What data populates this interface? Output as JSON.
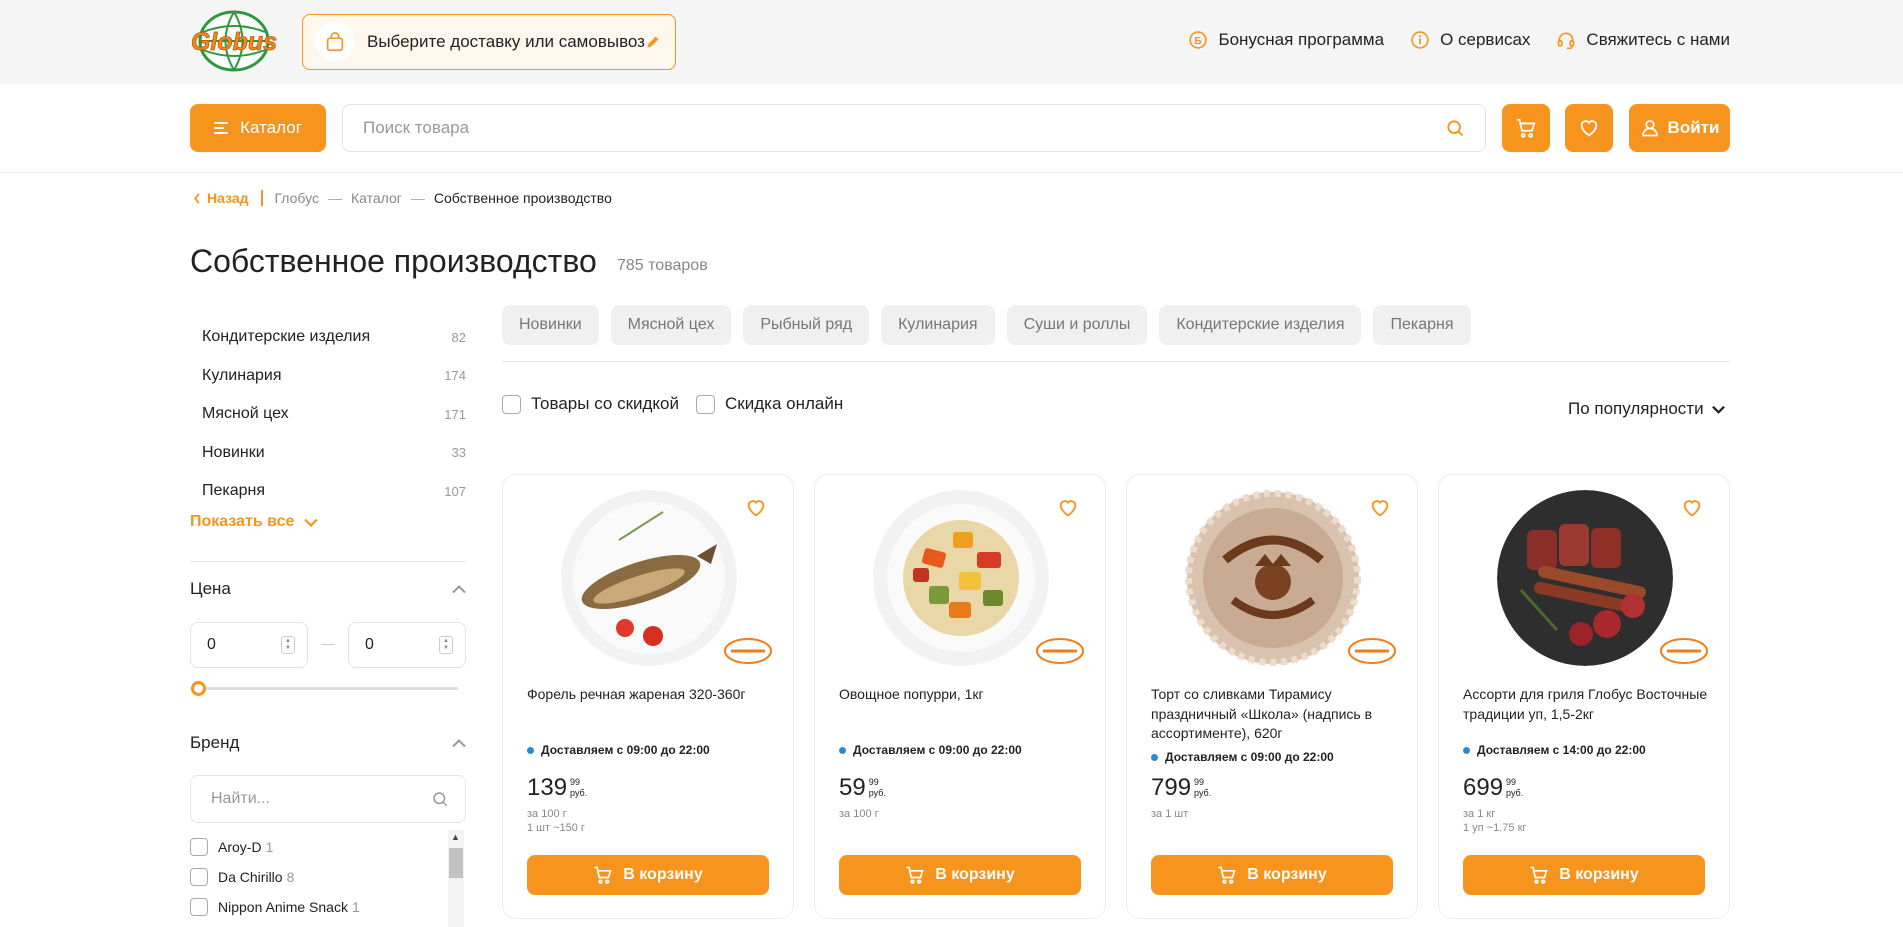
{
  "header": {
    "logo_text": "Globus",
    "delivery_label": "Выберите доставку или самовывоз",
    "links": [
      {
        "label": "Бонусная программа",
        "icon": "bonus-coin-icon"
      },
      {
        "label": "О сервисах",
        "icon": "info-icon"
      },
      {
        "label": "Свяжитесь с нами",
        "icon": "headset-icon"
      }
    ]
  },
  "toolbar": {
    "catalog_label": "Каталог",
    "search_placeholder": "Поиск товара",
    "login_label": "Войти"
  },
  "breadcrumb": {
    "back_label": "Назад",
    "items": [
      "Глобус",
      "Каталог",
      "Собственное производство"
    ]
  },
  "page": {
    "title": "Собственное производство",
    "count": "785 товаров"
  },
  "sidebar": {
    "categories": [
      {
        "name": "Кондитерские изделия",
        "count": "82"
      },
      {
        "name": "Кулинария",
        "count": "174"
      },
      {
        "name": "Мясной цех",
        "count": "171"
      },
      {
        "name": "Новинки",
        "count": "33"
      },
      {
        "name": "Пекарня",
        "count": "107"
      }
    ],
    "show_all_label": "Показать все",
    "price": {
      "title": "Цена",
      "min": "0",
      "max": "0"
    },
    "brand": {
      "title": "Бренд",
      "search_placeholder": "Найти...",
      "items": [
        {
          "name": "Aroy-D",
          "count": "1"
        },
        {
          "name": "Da Chirillo",
          "count": "8"
        },
        {
          "name": "Nippon Anime Snack",
          "count": "1"
        }
      ]
    }
  },
  "chips": [
    "Новинки",
    "Мясной цех",
    "Рыбный ряд",
    "Кулинария",
    "Суши и роллы",
    "Кондитерские изделия",
    "Пекарня"
  ],
  "filters": {
    "discount_label": "Товары со скидкой",
    "online_discount_label": "Скидка онлайн",
    "sort_label": "По популярности"
  },
  "products": [
    {
      "name": "Форель речная жареная 320-360г",
      "delivery": "Доставляем с 09:00 до 22:00",
      "price_main": "139",
      "price_kop": "99",
      "currency": "руб.",
      "unit_line1": "за 100 г",
      "unit_line2": "1 шт ~150 г",
      "button": "В корзину"
    },
    {
      "name": "Овощное попурри, 1кг",
      "delivery": "Доставляем с 09:00 до 22:00",
      "price_main": "59",
      "price_kop": "99",
      "currency": "руб.",
      "unit_line1": "за 100 г",
      "unit_line2": "",
      "button": "В корзину"
    },
    {
      "name": "Торт со сливками Тирамису праздничный «Школа» (надпись в ассортименте), 620г",
      "delivery": "Доставляем с 09:00 до 22:00",
      "price_main": "799",
      "price_kop": "99",
      "currency": "руб.",
      "unit_line1": "за 1 шт",
      "unit_line2": "",
      "button": "В корзину"
    },
    {
      "name": "Ассорти для гриля Глобус Восточные традиции уп, 1,5-2кг",
      "delivery": "Доставляем с 14:00 до 22:00",
      "price_main": "699",
      "price_kop": "99",
      "currency": "руб.",
      "unit_line1": "за 1 кг",
      "unit_line2": "1 уп ~1.75 кг",
      "button": "В корзину"
    }
  ],
  "colors": {
    "accent": "#f7941d",
    "delivery_dot": "#2b8acb"
  }
}
